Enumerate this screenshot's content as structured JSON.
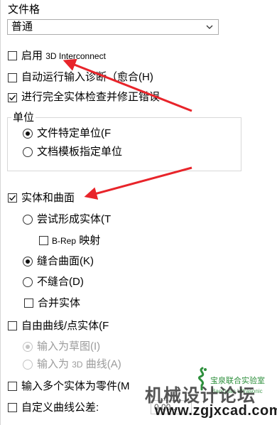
{
  "file_format": {
    "label": "文件格",
    "selected": "普通"
  },
  "options": {
    "enable_3d_interconnect": {
      "prefix": "启用",
      "suffix": "3D Interconnect",
      "checked": false
    },
    "auto_diagnose": {
      "label": "自动运行输入诊断（愈合(H)",
      "checked": false
    },
    "full_check": {
      "label": "进行完全实体检查并修正错误",
      "checked": true
    }
  },
  "units": {
    "title": "单位",
    "file_specific": {
      "label": "文件特定单位(F",
      "selected": true
    },
    "template_specified": {
      "label": "文档模板指定单位",
      "selected": false
    }
  },
  "solids_surfaces": {
    "label": "实体和曲面",
    "checked": true,
    "try_form_solid": {
      "label": "尝试形成实体(T",
      "selected": false
    },
    "brep_mapping": {
      "prefix": "B-Rep",
      "suffix": "映射",
      "checked": false
    },
    "knit_surfaces": {
      "label": "缝合曲面(K)",
      "selected": true
    },
    "no_knit": {
      "label": "不缝合(D)",
      "selected": false
    },
    "merge_solids": {
      "label": "合并实体",
      "checked": false
    }
  },
  "free_curves": {
    "label": "自由曲线/点实体(F",
    "checked": false,
    "as_sketch": {
      "label": "输入为草图(I)",
      "selected": true
    },
    "as_3d_curve": {
      "prefix": "输入为",
      "middle": "3D",
      "suffix": "曲线(A)",
      "selected": false
    }
  },
  "multiple_bodies": {
    "label": "输入多个实体为零件(M",
    "checked": false
  },
  "custom_tolerance": {
    "label": "自定义曲线公差:",
    "checked": false,
    "value": "0.00..."
  },
  "watermark": {
    "org_cn": "宝泉联合实验室",
    "org_en": "BaoQuan Ultrasonic",
    "site_cn": "机械设计论坛",
    "url": "www.zgjxcad.com"
  },
  "colors": {
    "annotation_arrow": "#e8242a",
    "watermark_green": "#2d8f3c"
  }
}
